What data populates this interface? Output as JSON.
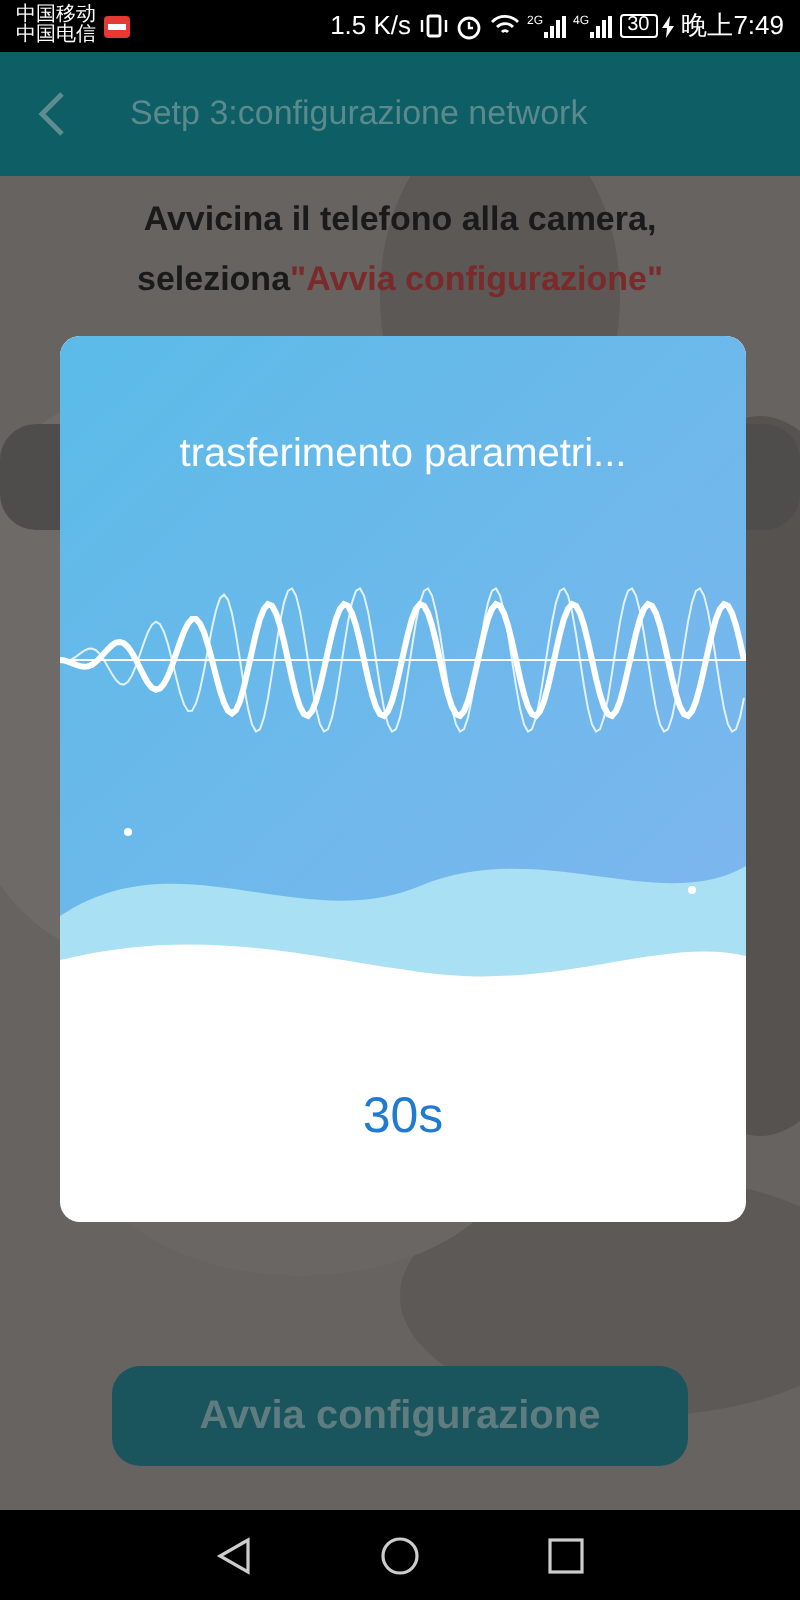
{
  "status_bar": {
    "carriers": [
      "中国移动",
      "中国电信"
    ],
    "speed": "1.5 K/s",
    "signals": [
      {
        "label": "2G"
      },
      {
        "label": "4G"
      }
    ],
    "battery": "30",
    "time": "晚上7:49"
  },
  "header": {
    "title": "Setp 3:configurazione network"
  },
  "instructions": [
    [
      {
        "text": "Avvicina il telefono alla camera,",
        "highlight": false
      }
    ],
    [
      {
        "text": "seleziona",
        "highlight": false
      },
      {
        "text": "\"Avvia configurazione\"",
        "highlight": true
      }
    ]
  ],
  "dialog": {
    "message": "trasferimento parametri...",
    "countdown": "30s"
  },
  "button": {
    "label": "Avvia configurazione"
  }
}
